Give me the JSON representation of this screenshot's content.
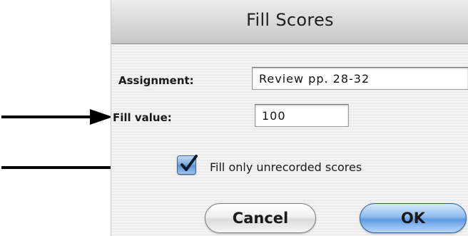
{
  "dialog": {
    "title": "Fill Scores",
    "assignment": {
      "label": "Assignment:",
      "value": "Review pp. 28-32"
    },
    "fill_value": {
      "label": "Fill value:",
      "value": "100"
    },
    "fill_unrecorded": {
      "label": "Fill only unrecorded scores",
      "checked": true
    },
    "buttons": {
      "cancel": "Cancel",
      "ok": "OK"
    }
  },
  "annotations": {
    "arrow_icon": "right-arrow-icon",
    "arrow_color": "#000000"
  },
  "colors": {
    "checkbox_accent": "#6e9fdc",
    "default_button": "#8ebbee"
  }
}
